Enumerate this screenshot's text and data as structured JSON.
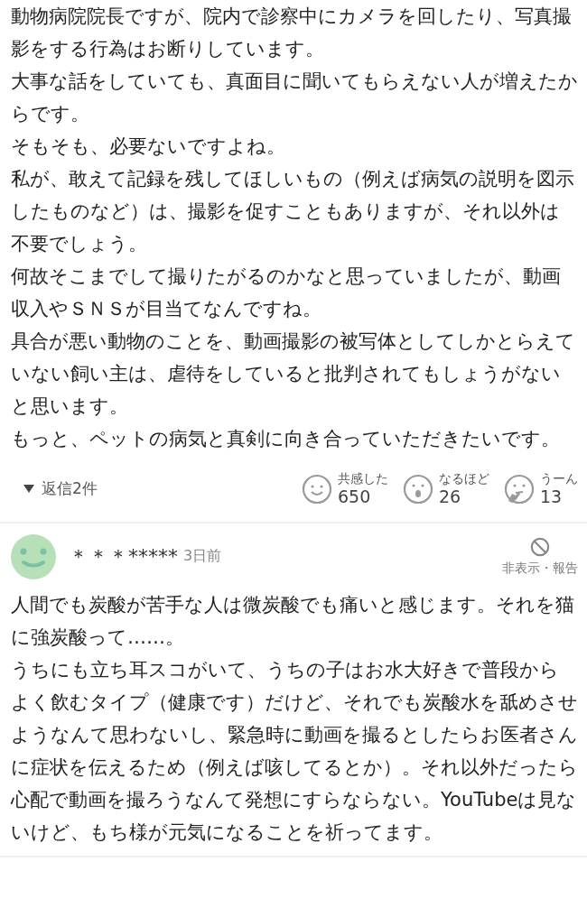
{
  "comments": [
    {
      "paragraphs": [
        "動物病院院長ですが、院内で診察中にカメラを回したり、写真撮影をする行為はお断りしています。",
        "大事な話をしていても、真面目に聞いてもらえない人が増えたからです。",
        "そもそも、必要ないですよね。",
        "私が、敢えて記録を残してほしいもの（例えば病気の説明を図示したものなど）は、撮影を促すこともありますが、それ以外は不要でしょう。",
        "何故そこまでして撮りたがるのかなと思っていましたが、動画収入やＳＮＳが目当てなんですね。",
        "具合が悪い動物のことを、動画撮影の被写体としてしかとらえていない飼い主は、虐待をしていると批判されてもしょうがないと思います。",
        "もっと、ペットの病気と真剣に向き合っていただきたいです。"
      ],
      "replies": "返信2件",
      "reactions": [
        {
          "kind": "smile",
          "label": "共感した",
          "count": "650"
        },
        {
          "kind": "wow",
          "label": "なるほど",
          "count": "26"
        },
        {
          "kind": "hmm",
          "label": "うーん",
          "count": "13"
        }
      ]
    },
    {
      "user": {
        "name": "＊＊＊*****",
        "time": "3日前"
      },
      "hide_report": "非表示・報告",
      "paragraphs": [
        "人間でも炭酸が苦手な人は微炭酸でも痛いと感じます。それを猫に強炭酸って……。",
        "うちにも立ち耳スコがいて、うちの子はお水大好きで普段からよく飲むタイプ（健康です）だけど、それでも炭酸水を舐めさせようなんて思わないし、緊急時に動画を撮るとしたらお医者さんに症状を伝えるため（例えば咳してるとか）。それ以外だったら心配で動画を撮ろうなんて発想にすらならない。YouTubeは見ないけど、もち様が元気になることを祈ってます。"
      ]
    }
  ]
}
